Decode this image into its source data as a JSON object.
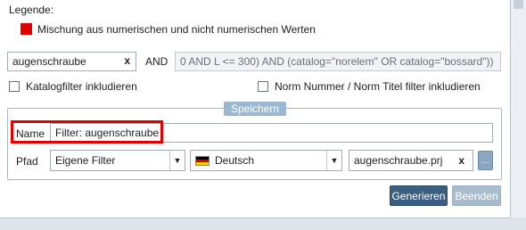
{
  "legend": {
    "title": "Legende:",
    "swatch_color": "#e00000",
    "items": [
      {
        "label": "Mischung aus numerischen und nicht numerischen Werten"
      }
    ]
  },
  "search": {
    "value": "augenschraube",
    "clear_label": "x"
  },
  "operator": "AND",
  "expression": {
    "value": "0 AND L <= 300) AND (catalog=\"norelem\" OR catalog=\"bossard\"))"
  },
  "checkboxes": {
    "catalog_filter": {
      "label": "Katalogfilter inkludieren",
      "checked": false
    },
    "norm_filter": {
      "label": "Norm Nummer / Norm Titel filter inkludieren",
      "checked": false
    }
  },
  "save_group": {
    "title": "Speichern",
    "name_label": "Name",
    "name_value": "Filter: augenschraube",
    "path_label": "Pfad",
    "path_value": "Eigene Filter",
    "language_value": "Deutsch",
    "file_value": "augenschraube.prj",
    "file_clear_label": "x",
    "browse_label": "..."
  },
  "buttons": {
    "generate": "Generieren",
    "close": "Beenden"
  },
  "colors": {
    "highlight": "#e00000",
    "primary_button": "#3a5f80",
    "disabled_button": "#a9bccd",
    "group_tab": "#9bb8d3"
  }
}
